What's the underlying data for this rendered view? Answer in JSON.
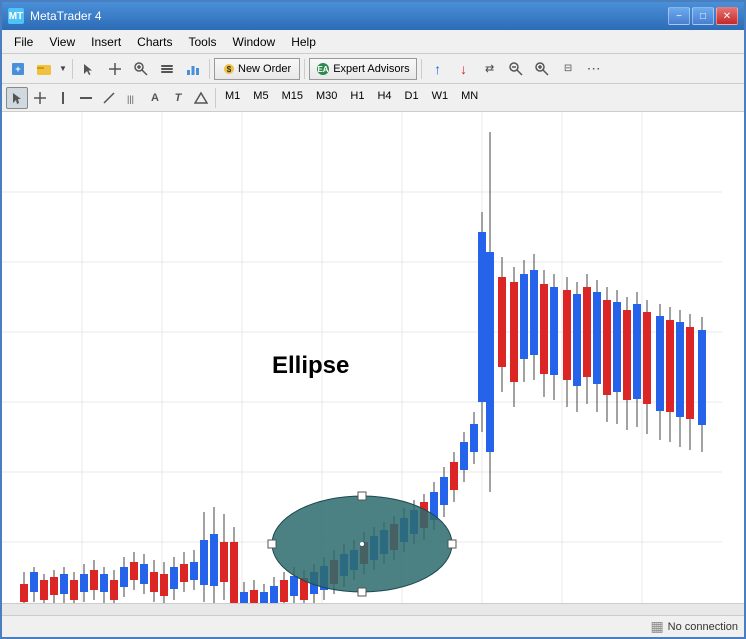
{
  "window": {
    "title": "MetaTrader 4",
    "icon": "MT"
  },
  "titlebar": {
    "title": "MetaTrader 4",
    "minimize_label": "−",
    "maximize_label": "□",
    "close_label": "✕"
  },
  "menubar": {
    "items": [
      {
        "id": "file",
        "label": "File"
      },
      {
        "id": "view",
        "label": "View"
      },
      {
        "id": "insert",
        "label": "Insert"
      },
      {
        "id": "charts",
        "label": "Charts"
      },
      {
        "id": "tools",
        "label": "Tools"
      },
      {
        "id": "window",
        "label": "Window"
      },
      {
        "id": "help",
        "label": "Help"
      }
    ]
  },
  "toolbar1": {
    "new_order_label": "New Order",
    "expert_advisors_label": "Expert Advisors"
  },
  "toolbar2": {
    "timeframes": [
      "M1",
      "M5",
      "M15",
      "M30",
      "H1",
      "H4",
      "D1",
      "W1",
      "MN"
    ]
  },
  "chart": {
    "ellipse_label": "Ellipse",
    "ellipse_color": "#2d6b6e",
    "ellipse_opacity": 0.85
  },
  "statusbar": {
    "connection_icon": "▦",
    "connection_status": "No connection"
  }
}
